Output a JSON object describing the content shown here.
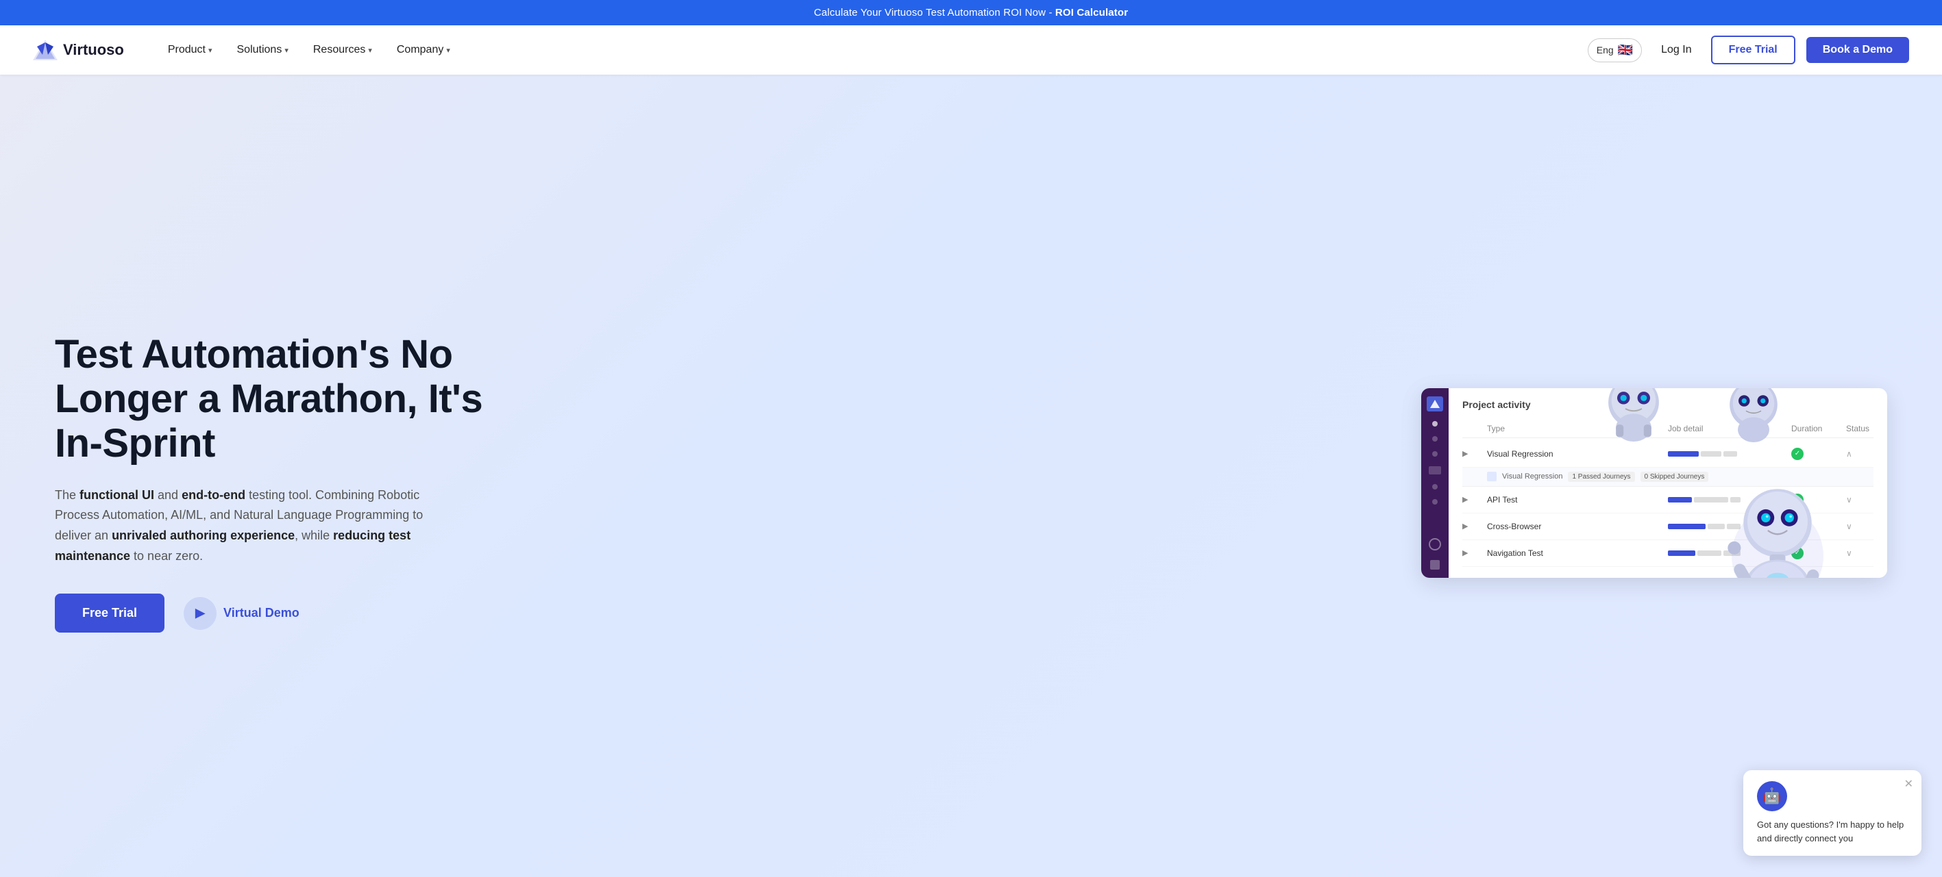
{
  "banner": {
    "text": "Calculate Your Virtuoso Test Automation ROI Now - ",
    "link_text": "ROI Calculator"
  },
  "header": {
    "logo_text": "Virtuoso",
    "nav_items": [
      {
        "label": "Product",
        "has_dropdown": true
      },
      {
        "label": "Solutions",
        "has_dropdown": true
      },
      {
        "label": "Resources",
        "has_dropdown": true
      },
      {
        "label": "Company",
        "has_dropdown": true
      }
    ],
    "lang_label": "Eng",
    "login_label": "Log In",
    "free_trial_label": "Free Trial",
    "book_demo_label": "Book a Demo"
  },
  "hero": {
    "title": "Test Automation's No Longer a Marathon, It's In-Sprint",
    "description_parts": [
      "The ",
      "functional UI",
      " and ",
      "end-to-end",
      " testing tool. Combining Robotic Process Automation, AI/ML, and Natural Language Programming to deliver an ",
      "unrivaled authoring experience",
      ", while ",
      "reducing test maintenance",
      " to near zero."
    ],
    "free_trial_label": "Free Trial",
    "virtual_demo_label": "Virtual Demo"
  },
  "dashboard": {
    "title": "Project activity",
    "columns": [
      "",
      "Type",
      "Job detail",
      "Duration",
      "Status",
      ""
    ],
    "rows": [
      {
        "name": "Visual Regression",
        "duration_bar": true,
        "status": "success",
        "expandable": true,
        "sub_rows": [
          {
            "label": "Visual Regression",
            "passed": "1 Passed Journeys",
            "skipped": "0 Skipped Journeys"
          }
        ]
      },
      {
        "name": "API Test",
        "duration_bar": true,
        "status": "success",
        "expandable": true
      },
      {
        "name": "Cross-Browser",
        "duration_bar": true,
        "status": "success",
        "expandable": true
      },
      {
        "name": "Navigation Test",
        "duration_bar": true,
        "status": "success",
        "expandable": true
      }
    ]
  },
  "chat": {
    "text": "Got any questions? I'm happy to help and directly connect you",
    "avatar": "🤖"
  }
}
